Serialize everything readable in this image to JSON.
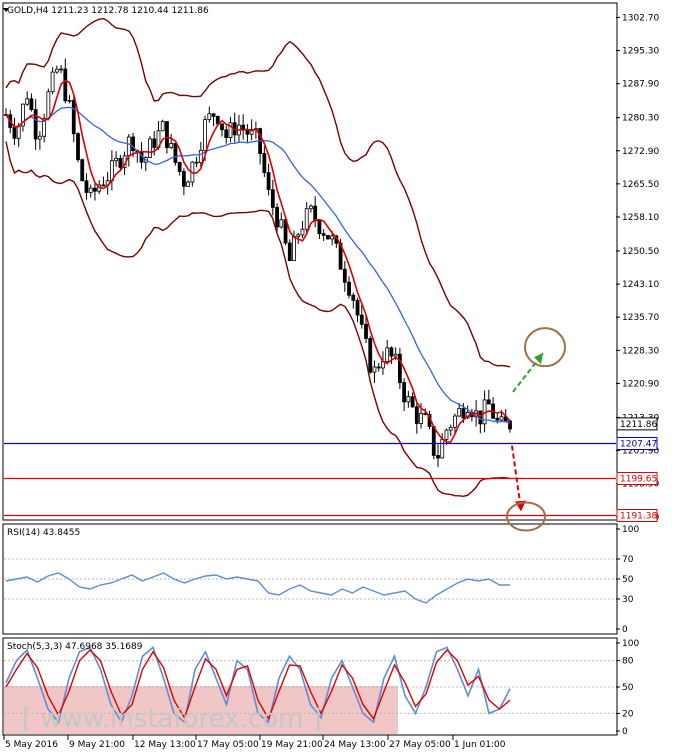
{
  "chart_data": [
    {
      "type": "candlestick",
      "title": "GOLD,H4  1211.23 1212.78 1210.44 1211.86",
      "symbol": "GOLD",
      "timeframe": "H4",
      "ohlc_header": {
        "open": 1211.23,
        "high": 1212.78,
        "low": 1210.44,
        "close": 1211.86
      },
      "y_ticks": [
        "1302.70",
        "1295.30",
        "1287.90",
        "1280.30",
        "1272.90",
        "1265.50",
        "1258.10",
        "1250.50",
        "1243.10",
        "1235.70",
        "1228.30",
        "1220.90",
        "1213.30",
        "1205.90",
        "1198.50",
        "1191.10"
      ],
      "ylim": [
        1190.6,
        1305.7
      ],
      "x_ticks": [
        "5 May 2016",
        "9 May 21:00",
        "12 May 13:00",
        "17 May 05:00",
        "19 May 21:00",
        "24 May 13:00",
        "27 May 05:00",
        "1 Jun 01:00"
      ],
      "close_path": [
        1281,
        1277,
        1286,
        1276,
        1285,
        1292,
        1283,
        1268,
        1262,
        1266,
        1268,
        1272,
        1276,
        1270,
        1275,
        1278,
        1271,
        1266,
        1271,
        1279,
        1282,
        1276,
        1279,
        1277,
        1275,
        1263,
        1257,
        1248,
        1256,
        1259,
        1256,
        1253,
        1247,
        1241,
        1231,
        1223,
        1228,
        1226,
        1218,
        1214,
        1212,
        1204,
        1211,
        1214,
        1217,
        1213,
        1216,
        1211,
        1212
      ],
      "indicators": [
        "Bollinger Bands",
        "Moving Average (red)",
        "Moving Average (blue)"
      ],
      "levels": [
        {
          "label": "1211.86",
          "value": 1211.86,
          "color": "#000000",
          "kind": "current price"
        },
        {
          "label": "1207.47",
          "value": 1207.47,
          "color": "#0000c8",
          "kind": "support"
        },
        {
          "label": "1199.65",
          "value": 1199.65,
          "color": "#e00000",
          "kind": "support"
        },
        {
          "label": "1191.38",
          "value": 1191.38,
          "color": "#e00000",
          "kind": "support"
        }
      ],
      "annotations": [
        {
          "kind": "arrow-up",
          "color": "#2ca02c",
          "target_value": 1229
        },
        {
          "kind": "arrow-down",
          "color": "#e00000",
          "target_value": 1191.38
        }
      ]
    },
    {
      "type": "line",
      "title": "RSI(14) 43.8455",
      "y_ticks": [
        "100",
        "70",
        "50",
        "30",
        "0"
      ],
      "ylim": [
        0,
        100
      ],
      "levels": [
        70,
        50,
        30
      ],
      "series": [
        {
          "color": "#5b8fd6",
          "values": [
            48,
            50,
            52,
            47,
            53,
            56,
            50,
            42,
            40,
            44,
            46,
            50,
            54,
            48,
            52,
            56,
            50,
            46,
            50,
            53,
            54,
            50,
            52,
            50,
            48,
            36,
            34,
            40,
            44,
            38,
            36,
            34,
            40,
            36,
            42,
            38,
            34,
            36,
            38,
            30,
            26,
            34,
            40,
            46,
            50,
            48,
            50,
            44,
            44
          ]
        }
      ]
    },
    {
      "type": "line",
      "title": "Stoch(5,3,3) 47.6968 35.1689",
      "y_ticks": [
        "100",
        "80",
        "50",
        "20",
        "0"
      ],
      "ylim": [
        0,
        100
      ],
      "levels": [
        80,
        50,
        20
      ],
      "series": [
        {
          "color": "#5b8fd6",
          "values": [
            55,
            80,
            92,
            60,
            25,
            10,
            60,
            90,
            95,
            70,
            30,
            10,
            40,
            85,
            95,
            60,
            20,
            10,
            70,
            90,
            60,
            30,
            80,
            70,
            20,
            10,
            60,
            85,
            70,
            30,
            15,
            60,
            80,
            50,
            20,
            10,
            60,
            85,
            40,
            20,
            50,
            90,
            95,
            70,
            40,
            70,
            20,
            25,
            48
          ]
        },
        {
          "color": "#e00000",
          "values": [
            50,
            70,
            88,
            72,
            40,
            18,
            45,
            80,
            92,
            80,
            45,
            18,
            30,
            70,
            90,
            72,
            35,
            15,
            50,
            82,
            70,
            40,
            70,
            74,
            35,
            14,
            45,
            75,
            74,
            45,
            20,
            45,
            75,
            60,
            30,
            14,
            45,
            75,
            55,
            28,
            42,
            78,
            92,
            80,
            52,
            62,
            35,
            25,
            35
          ]
        }
      ]
    }
  ],
  "watermark": "[ www.instaforex.com ]"
}
